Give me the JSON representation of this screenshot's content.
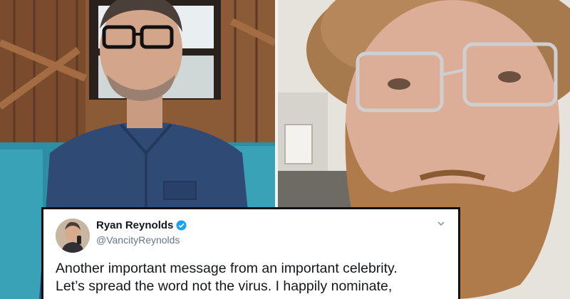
{
  "tweet": {
    "display_name": "Ryan Reynolds",
    "handle": "@VancityReynolds",
    "text_lines": [
      "Another important message from an important celebrity.",
      "Let’s spread the word not the virus. I happily nominate,"
    ]
  },
  "colors": {
    "verified_badge": "#1da1f2",
    "handle_gray": "#657786",
    "tweet_text": "#14171a"
  },
  "icons": {
    "verified": "verified-badge-icon",
    "menu": "chevron-down-icon"
  }
}
